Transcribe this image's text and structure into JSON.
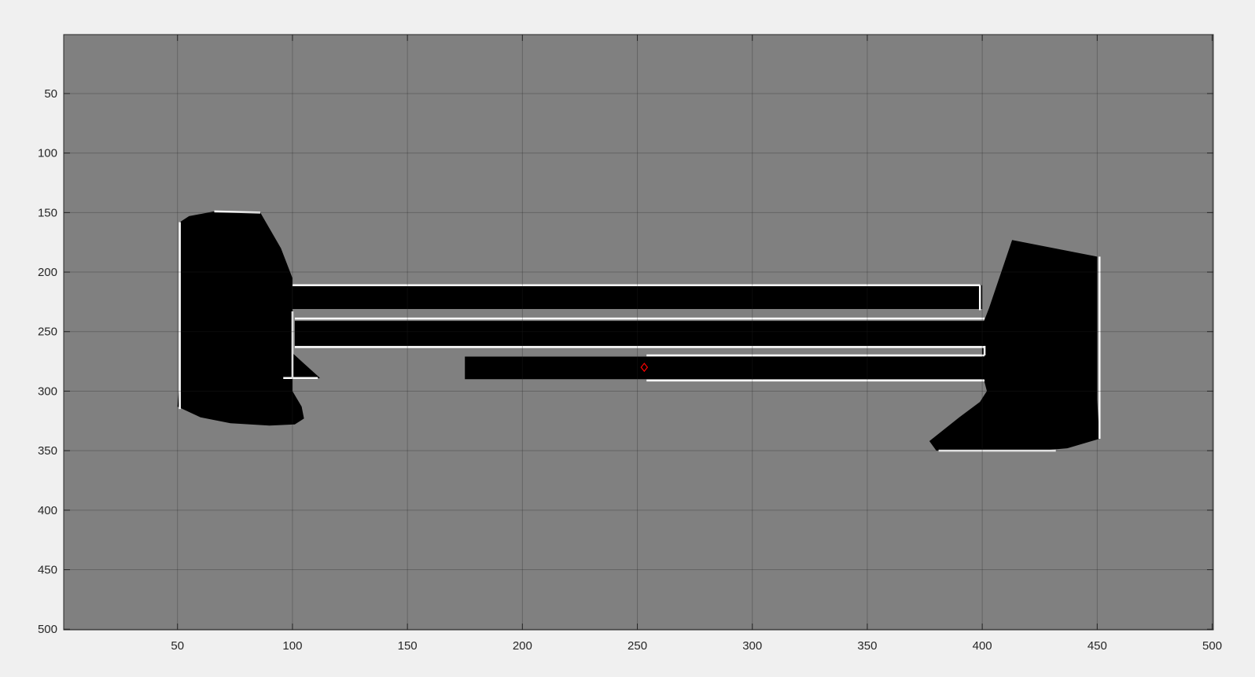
{
  "chart_data": {
    "type": "heatmap",
    "title": "",
    "xlabel": "",
    "ylabel": "",
    "xlim": [
      0.5,
      500.5
    ],
    "ylim": [
      0.5,
      500.5
    ],
    "y_direction": "reversed",
    "grid": true,
    "xticks": [
      50,
      100,
      150,
      200,
      250,
      300,
      350,
      400,
      450,
      500
    ],
    "yticks": [
      50,
      100,
      150,
      200,
      250,
      300,
      350,
      400,
      450,
      500
    ],
    "colors": {
      "background": "#808080",
      "obstacle": "#000000",
      "edge": "#ffffff",
      "marker": "#ff0000"
    },
    "regions": [
      {
        "name": "left-block",
        "polygon": [
          [
            51,
            158
          ],
          [
            55,
            153
          ],
          [
            66,
            149
          ],
          [
            86,
            150
          ],
          [
            95,
            180
          ],
          [
            100,
            205
          ],
          [
            100,
            300
          ],
          [
            104,
            313
          ],
          [
            105,
            323
          ],
          [
            101,
            328
          ],
          [
            90,
            329
          ],
          [
            73,
            327
          ],
          [
            60,
            322
          ],
          [
            50,
            313
          ],
          [
            51,
            290
          ]
        ]
      },
      {
        "name": "left-notch",
        "polygon": [
          [
            100,
            268
          ],
          [
            104,
            275
          ],
          [
            112,
            289
          ],
          [
            100,
            289
          ]
        ]
      },
      {
        "name": "right-block",
        "polygon": [
          [
            413,
            173
          ],
          [
            450,
            187
          ],
          [
            450,
            307
          ],
          [
            451,
            340
          ],
          [
            437,
            348
          ],
          [
            425,
            350
          ],
          [
            380,
            350
          ],
          [
            377,
            342
          ],
          [
            390,
            322
          ],
          [
            399,
            309
          ],
          [
            402,
            300
          ],
          [
            400,
            285
          ],
          [
            400,
            245
          ],
          [
            403,
            230
          ]
        ]
      },
      {
        "name": "bar-top",
        "polygon": [
          [
            100,
            211
          ],
          [
            400,
            211
          ],
          [
            400,
            231
          ],
          [
            100,
            231
          ]
        ]
      },
      {
        "name": "bar-middle",
        "polygon": [
          [
            101,
            241
          ],
          [
            402,
            241
          ],
          [
            402,
            262
          ],
          [
            101,
            262
          ]
        ]
      },
      {
        "name": "bar-bottom",
        "polygon": [
          [
            175,
            271
          ],
          [
            402,
            271
          ],
          [
            402,
            290
          ],
          [
            175,
            290
          ]
        ]
      }
    ],
    "edges": [
      [
        [
          51,
          158
        ],
        [
          51,
          315
        ]
      ],
      [
        [
          66,
          149
        ],
        [
          86,
          150
        ]
      ],
      [
        [
          100,
          233
        ],
        [
          100,
          289
        ]
      ],
      [
        [
          96,
          289
        ],
        [
          111,
          289
        ]
      ],
      [
        [
          100,
          211
        ],
        [
          399,
          211
        ]
      ],
      [
        [
          101,
          239
        ],
        [
          401,
          239
        ]
      ],
      [
        [
          101,
          263
        ],
        [
          401,
          263
        ]
      ],
      [
        [
          254,
          270
        ],
        [
          401,
          270
        ]
      ],
      [
        [
          254,
          291
        ],
        [
          401,
          291
        ]
      ],
      [
        [
          399,
          211
        ],
        [
          399,
          232
        ]
      ],
      [
        [
          401,
          262
        ],
        [
          401,
          270
        ]
      ],
      [
        [
          451,
          187
        ],
        [
          451,
          340
        ]
      ],
      [
        [
          381,
          350
        ],
        [
          432,
          350
        ]
      ]
    ],
    "markers": [
      {
        "shape": "diamond",
        "x": 253,
        "y": 280
      }
    ]
  }
}
